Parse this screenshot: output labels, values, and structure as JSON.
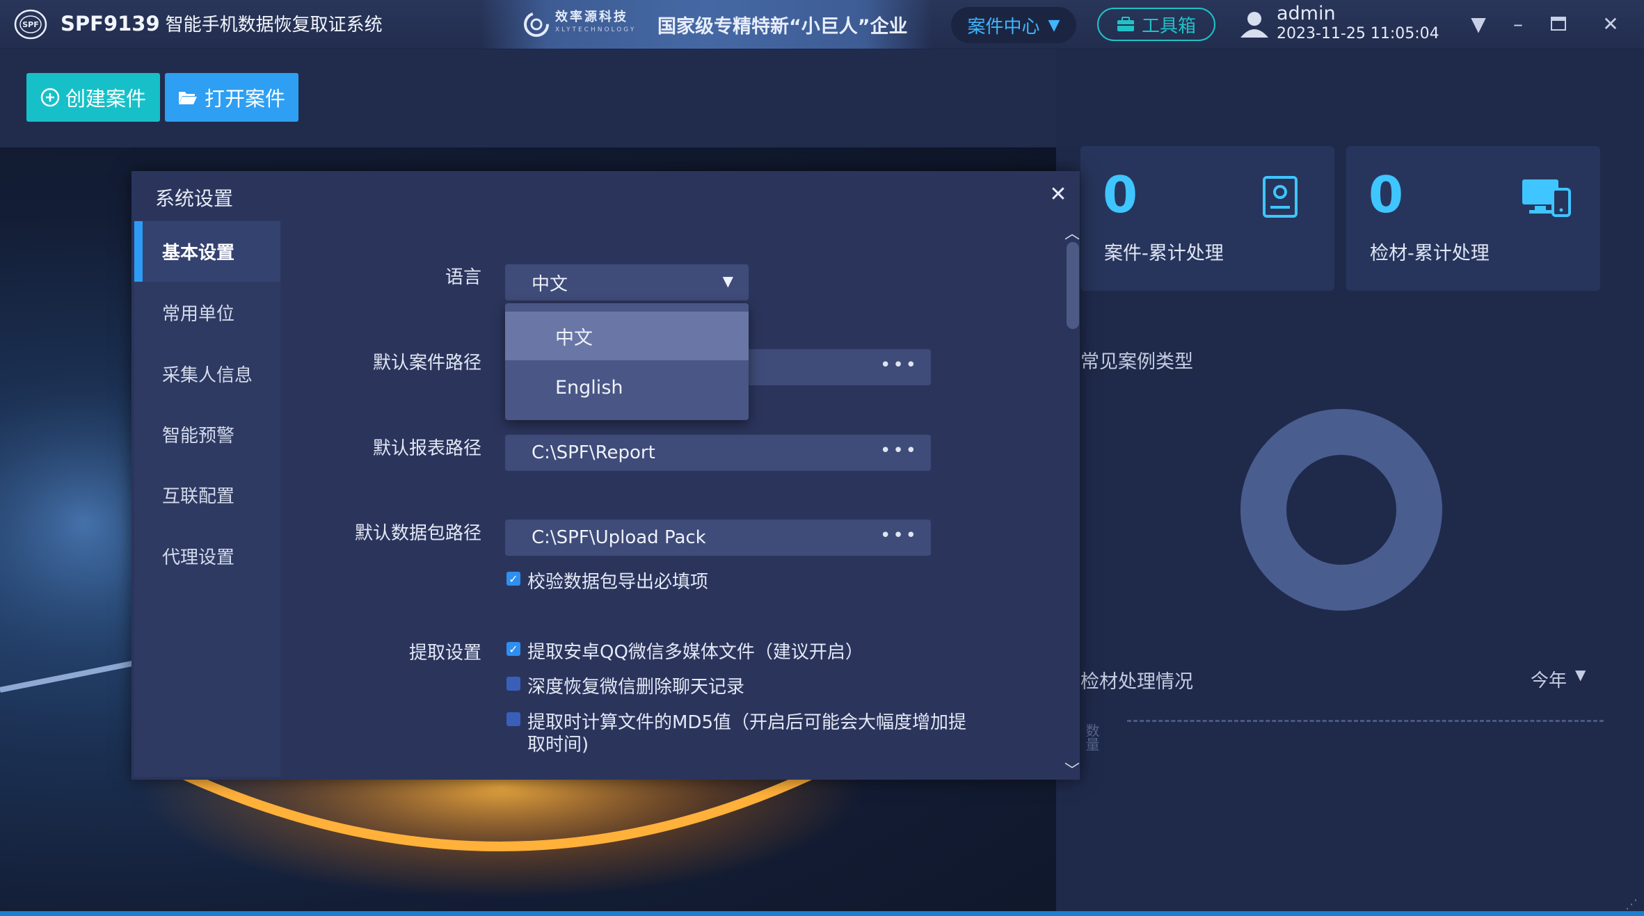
{
  "app": {
    "title": "SPF9139",
    "subtitle": "智能手机数据恢复取证系统",
    "logo_text": "SPF",
    "banner_company": "效率源科技",
    "banner_company_en": "XLYTECHNOLOGY",
    "banner_slogan": "国家级专精特新“小巨人”企业"
  },
  "header": {
    "case_center": "案件中心",
    "toolbox": "工具箱",
    "user_name": "admin",
    "datetime": "2023-11-25 11:05:04"
  },
  "actions": {
    "create_case": "创建案件",
    "open_case": "打开案件"
  },
  "stats": [
    {
      "value": "0",
      "label": "案件-累计处理",
      "icon": "id-card-icon"
    },
    {
      "value": "0",
      "label": "检材-累计处理",
      "icon": "devices-icon"
    }
  ],
  "charts": {
    "common_case_types": "常见案例类型",
    "exam_processing": "检材处理情况",
    "period": "今年",
    "y_axis_label": "数量"
  },
  "chart_data": {
    "type": "pie",
    "title": "常见案例类型",
    "categories": [],
    "values": []
  },
  "dialog": {
    "title": "系统设置",
    "nav": [
      "基本设置",
      "常用单位",
      "采集人信息",
      "智能预警",
      "互联配置",
      "代理设置"
    ],
    "active_nav": 0,
    "form": {
      "language_label": "语言",
      "language_value": "中文",
      "language_options": [
        "中文",
        "English"
      ],
      "case_path_label": "默认案件路径",
      "case_path_value": "",
      "report_path_label": "默认报表路径",
      "report_path_value": "C:\\SPF\\Report",
      "pack_path_label": "默认数据包路径",
      "pack_path_value": "C:\\SPF\\Upload Pack",
      "verify_pack": {
        "label": "校验数据包导出必填项",
        "checked": true
      },
      "extract_label": "提取设置",
      "extract_options": [
        {
          "label": "提取安卓QQ微信多媒体文件（建议开启）",
          "checked": true
        },
        {
          "label": "深度恢复微信删除聊天记录",
          "checked": false
        },
        {
          "label": "提取时计算文件的MD5值（开启后可能会大幅度增加提",
          "label2": "取时间)",
          "checked": false
        }
      ],
      "more_dots": "•••"
    }
  },
  "colors": {
    "accent_teal": "#17c0c8",
    "accent_blue": "#2e9ff2",
    "stat_number": "#3fc5ff",
    "dialog_bg": "#2b355c"
  }
}
